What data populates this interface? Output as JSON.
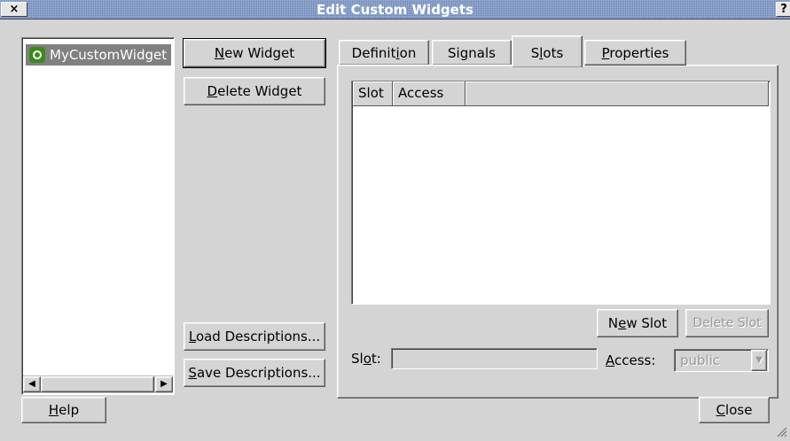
{
  "window": {
    "title": "Edit Custom Widgets",
    "close_glyph": "×",
    "help_glyph": "?"
  },
  "widget_list": {
    "items": [
      {
        "label": "MyCustomWidget",
        "icon": "qt-q-icon",
        "selected": true
      }
    ]
  },
  "buttons": {
    "new_widget": {
      "pre": "",
      "ul": "N",
      "post": "ew Widget"
    },
    "delete_widget": {
      "pre": "",
      "ul": "D",
      "post": "elete Widget"
    },
    "load_descriptions": {
      "pre": "",
      "ul": "L",
      "post": "oad Descriptions..."
    },
    "save_descriptions": {
      "pre": "",
      "ul": "S",
      "post": "ave Descriptions..."
    },
    "help": {
      "pre": "",
      "ul": "H",
      "post": "elp"
    },
    "close": {
      "pre": "",
      "ul": "C",
      "post": "lose"
    }
  },
  "tabs": [
    {
      "pre": "Definit",
      "ul": "i",
      "post": "on"
    },
    {
      "pre": "Si",
      "ul": "g",
      "post": "nals"
    },
    {
      "pre": "S",
      "ul": "l",
      "post": "ots"
    },
    {
      "pre": "",
      "ul": "P",
      "post": "roperties"
    }
  ],
  "active_tab": "Slots",
  "slots_table": {
    "columns": [
      "Slot",
      "Access"
    ],
    "rows": []
  },
  "slots_panel": {
    "new_slot": {
      "pre": "N",
      "ul": "e",
      "post": "w Slot"
    },
    "delete_slot": "Delete Slot",
    "slot_label": {
      "pre": "Sl",
      "ul": "o",
      "post": "t:"
    },
    "slot_value": "",
    "access_label": {
      "pre": "",
      "ul": "A",
      "post": "ccess:"
    },
    "access_value": "public"
  },
  "scroll_glyphs": {
    "left": "◀",
    "right": "▶",
    "down": "▼"
  }
}
